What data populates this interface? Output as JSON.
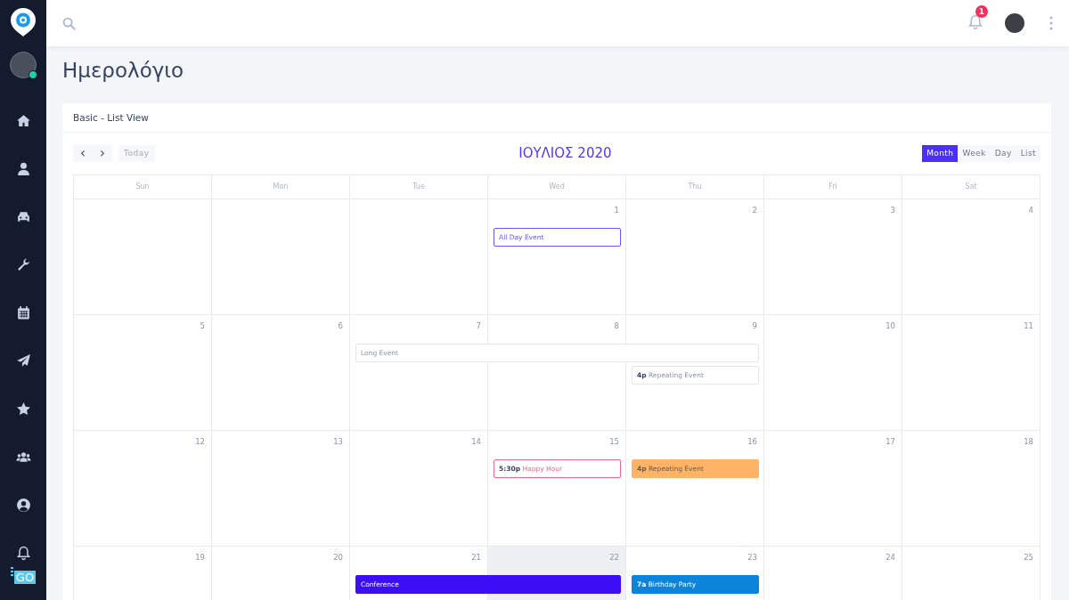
{
  "sidebar": {
    "avatar": {
      "online": true
    },
    "footer_logo": "GO"
  },
  "topbar": {
    "notifications": "1"
  },
  "page_title": "Ημερολόγιο",
  "card": {
    "title": "Basic - List View",
    "toolbar": {
      "prev": "‹",
      "next": "›",
      "today": "Today",
      "title": "ΙΟΥΛΙΟΣ 2020",
      "views": [
        {
          "label": "Month",
          "selected": true
        },
        {
          "label": "Week",
          "selected": false
        },
        {
          "label": "Day",
          "selected": false
        },
        {
          "label": "List",
          "selected": false
        }
      ]
    },
    "weekdays": [
      "Sun",
      "Mon",
      "Tue",
      "Wed",
      "Thu",
      "Fri",
      "Sat"
    ],
    "weeks": [
      {
        "days": [
          {
            "today": false
          },
          {
            "today": false
          },
          {
            "today": false
          },
          {
            "number": "1",
            "today": false,
            "events": [
              {
                "text": "All Day Event",
                "kind": "outline",
                "color": "#6a55f7"
              }
            ]
          },
          {
            "number": "2",
            "today": false
          },
          {
            "number": "3",
            "today": false
          },
          {
            "number": "4",
            "today": false
          }
        ]
      },
      {
        "days": [
          {
            "number": "5",
            "today": false
          },
          {
            "number": "6",
            "today": false
          },
          {
            "number": "7",
            "today": false,
            "events": [
              {
                "text": "Long Event",
                "kind": "outline",
                "color": "#e3e6ee"
              }
            ]
          },
          {
            "number": "8",
            "today": false,
            "events": [
              {
                "kind": "continued"
              }
            ]
          },
          {
            "number": "9",
            "today": false,
            "events": [
              {
                "kind": "continued"
              },
              {
                "text": "**4p** Repeating Event",
                "kind": "outline",
                "color": "#e3e6ee"
              }
            ]
          },
          {
            "number": "10",
            "today": false
          },
          {
            "number": "11",
            "today": false
          }
        ]
      },
      {
        "days": [
          {
            "number": "12",
            "today": false
          },
          {
            "number": "13",
            "today": false
          },
          {
            "number": "14",
            "today": false
          },
          {
            "number": "15",
            "today": false,
            "events": [
              {
                "text": "**5:30p** Happy Hour",
                "kind": "outline",
                "color": "#f2668b"
              }
            ]
          },
          {
            "number": "16",
            "today": false,
            "events": [
              {
                "text": "**4p** Repeating Event",
                "kind": "filled",
                "color": "#ffb366"
              }
            ]
          },
          {
            "number": "17",
            "today": false
          },
          {
            "number": "18",
            "today": false
          }
        ]
      },
      {
        "days": [
          {
            "number": "19",
            "today": false
          },
          {
            "number": "20",
            "today": false
          },
          {
            "number": "21",
            "today": false,
            "events": [
              {
                "text": "Conference",
                "kind": "filled",
                "color": "#3b0ef5"
              }
            ]
          },
          {
            "number": "22",
            "today": true,
            "events": [
              {
                "kind": "continued"
              }
            ]
          },
          {
            "number": "23",
            "today": false,
            "events": [
              {
                "text": "**7a** Birthday Party",
                "kind": "filled",
                "color": "#0b84d9"
              }
            ]
          },
          {
            "number": "24",
            "today": false
          },
          {
            "number": "25",
            "today": false
          }
        ]
      }
    ]
  }
}
